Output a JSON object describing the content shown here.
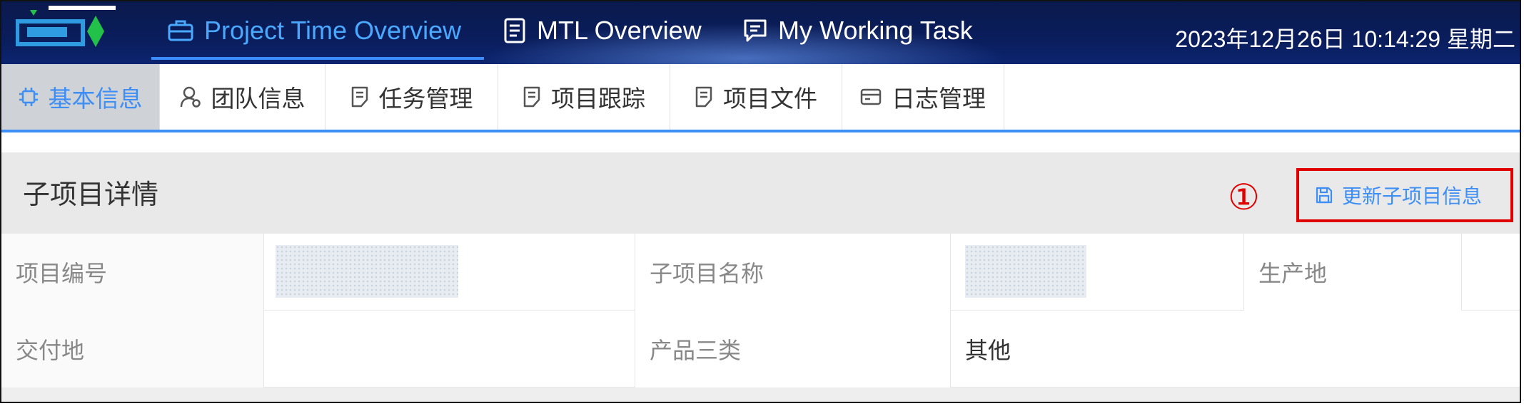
{
  "header": {
    "nav": [
      {
        "label": "Project Time Overview",
        "icon": "briefcase-icon",
        "active": true
      },
      {
        "label": "MTL Overview",
        "icon": "document-icon",
        "active": false
      },
      {
        "label": "My Working Task",
        "icon": "chat-icon",
        "active": false
      }
    ],
    "datetime": "2023年12月26日  10:14:29  星期二",
    "accent_color": "#3b8cff"
  },
  "tabs": [
    {
      "label": "基本信息",
      "icon": "chip-icon",
      "active": true
    },
    {
      "label": "团队信息",
      "icon": "user-icon",
      "active": false
    },
    {
      "label": "任务管理",
      "icon": "file-icon",
      "active": false
    },
    {
      "label": "项目跟踪",
      "icon": "file-icon",
      "active": false
    },
    {
      "label": "项目文件",
      "icon": "file-icon",
      "active": false
    },
    {
      "label": "日志管理",
      "icon": "card-icon",
      "active": false
    }
  ],
  "section": {
    "title": "子项目详情",
    "marker": "①",
    "update_button": "更新子项目信息"
  },
  "details": {
    "row1": {
      "project_no_label": "项目编号",
      "subproject_name_label": "子项目名称",
      "production_site_label": "生产地"
    },
    "row2": {
      "delivery_site_label": "交付地",
      "delivery_site_value": "",
      "product_category_label": "产品三类",
      "product_category_value": "其他"
    }
  },
  "colors": {
    "link_blue": "#3d8ef5",
    "highlight_red": "#e00000",
    "topbar_dark": "#0b1a4d"
  }
}
